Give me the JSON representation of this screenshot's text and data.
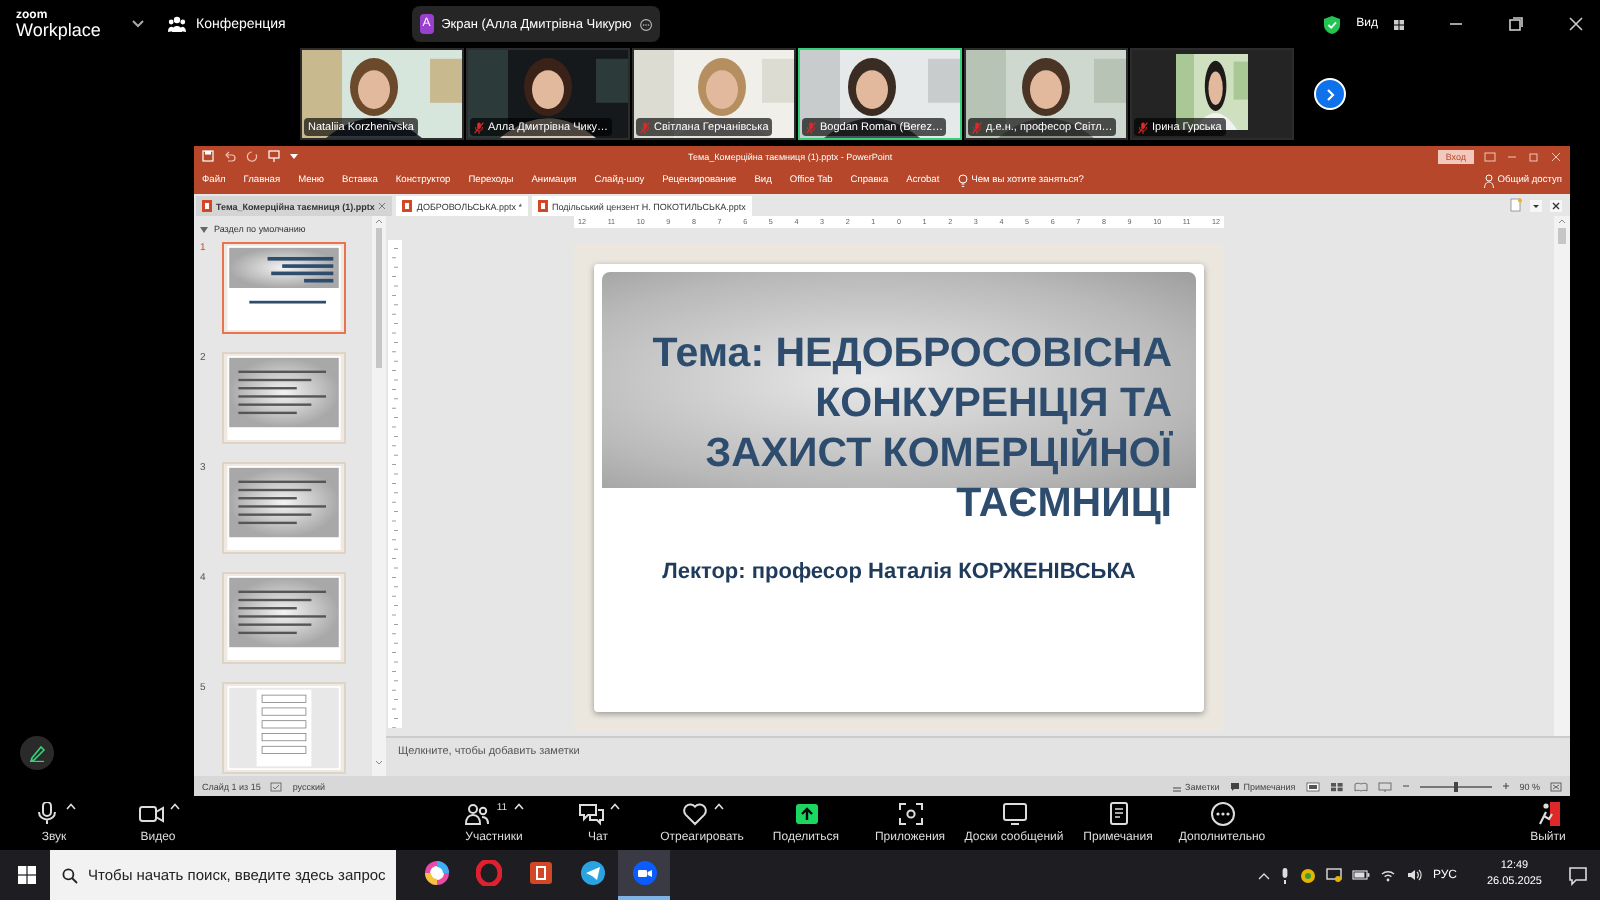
{
  "zoom_top_bar": {
    "logo_top": "zoom",
    "logo_bottom": "Workplace",
    "meeting_label": "Конференция",
    "share_pill": {
      "badge": "A",
      "label": "Экран (Алла Дмитрівна Чикурю"
    },
    "view_label": "Вид"
  },
  "video_tiles": [
    {
      "name": "Nataliia Korzhenivska",
      "muted": false,
      "speaking": false,
      "kind": "video"
    },
    {
      "name": "Алла Дмитрівна Чику…",
      "muted": true,
      "speaking": false,
      "kind": "video"
    },
    {
      "name": "Світлана Герчанівська",
      "muted": true,
      "speaking": false,
      "kind": "video"
    },
    {
      "name": "Bogdan Roman (Berez…",
      "muted": true,
      "speaking": true,
      "kind": "video"
    },
    {
      "name": "д.е.н., професор Світл…",
      "muted": true,
      "speaking": false,
      "kind": "video"
    },
    {
      "name": "Ірина Гурська",
      "muted": true,
      "speaking": false,
      "kind": "avatar"
    }
  ],
  "powerpoint": {
    "title": "Тема_Комерційна таємниця (1).pptx  -  PowerPoint",
    "sign_in": "Вход",
    "menu": [
      {
        "label": "Файл"
      },
      {
        "label": "Главная"
      },
      {
        "label": "Меню"
      },
      {
        "label": "Вставка"
      },
      {
        "label": "Конструктор"
      },
      {
        "label": "Переходы"
      },
      {
        "label": "Анимация"
      },
      {
        "label": "Слайд-шоу"
      },
      {
        "label": "Рецензирование"
      },
      {
        "label": "Вид"
      },
      {
        "label": "Office Tab"
      },
      {
        "label": "Справка"
      },
      {
        "label": "Acrobat"
      }
    ],
    "tell_me": "Чем вы хотите заняться?",
    "share": "Общий доступ",
    "document_tabs": [
      {
        "label": "Тема_Комерційна таємниця (1).pptx",
        "selected": true
      },
      {
        "label": "ДОБРОВОЛЬСЬКА.pptx *",
        "selected": false
      },
      {
        "label": "Подільський цензент Н. ПОКОТИЛЬСЬКА.pptx",
        "selected": false
      }
    ],
    "section_label": "Раздел по умолчанию",
    "thumbnails": [
      {
        "number": "1",
        "selected": true,
        "kind": "title"
      },
      {
        "number": "2",
        "selected": false,
        "kind": "text"
      },
      {
        "number": "3",
        "selected": false,
        "kind": "text"
      },
      {
        "number": "4",
        "selected": false,
        "kind": "text"
      },
      {
        "number": "5",
        "selected": false,
        "kind": "diagram"
      }
    ],
    "ruler_numbers": [
      "12",
      "11",
      "10",
      "9",
      "8",
      "7",
      "6",
      "5",
      "4",
      "3",
      "2",
      "1",
      "0",
      "1",
      "2",
      "3",
      "4",
      "5",
      "6",
      "7",
      "8",
      "9",
      "10",
      "11",
      "12"
    ],
    "slide": {
      "title": "Тема: НЕДОБРОСОВІСНА\nКОНКУРЕНЦІЯ ТА\nЗАХИСТ КОМЕРЦІЙНОЇ\nТАЄМНИЦІ",
      "subtitle": "Лектор: професор Наталія КОРЖЕНІВСЬКА"
    },
    "notes_placeholder": "Щелкните, чтобы добавить заметки",
    "status_bar": {
      "slide_counter": "Слайд 1 из 15",
      "language": "русский",
      "notes": "Заметки",
      "comments": "Примечания",
      "zoom": {
        "level": 0.5
      },
      "zoom_percent": "90 %"
    }
  },
  "zoom_toolbar": [
    {
      "label": "Звук",
      "menu": true
    },
    {
      "label": "Видео",
      "menu": true
    },
    {
      "label": "Участники",
      "menu": true,
      "badge": "11"
    },
    {
      "label": "Чат",
      "menu": true
    },
    {
      "label": "Отреагировать",
      "menu": true
    },
    {
      "label": "Поделиться",
      "menu": false
    },
    {
      "label": "Приложения",
      "menu": false
    },
    {
      "label": "Доски сообщений",
      "menu": false
    },
    {
      "label": "Примечания",
      "menu": false
    },
    {
      "label": "Дополнительно",
      "menu": false
    },
    {
      "label": "Выйти",
      "menu": false
    }
  ],
  "taskbar": {
    "search": {
      "placeholder": "Чтобы начать поиск, введите здесь запрос"
    },
    "apps": [
      {
        "selected": false
      },
      {
        "selected": false
      },
      {
        "selected": false
      },
      {
        "selected": false
      },
      {
        "selected": true
      }
    ],
    "language": "РУС",
    "time": "12:49",
    "date": "26.05.2025"
  }
}
